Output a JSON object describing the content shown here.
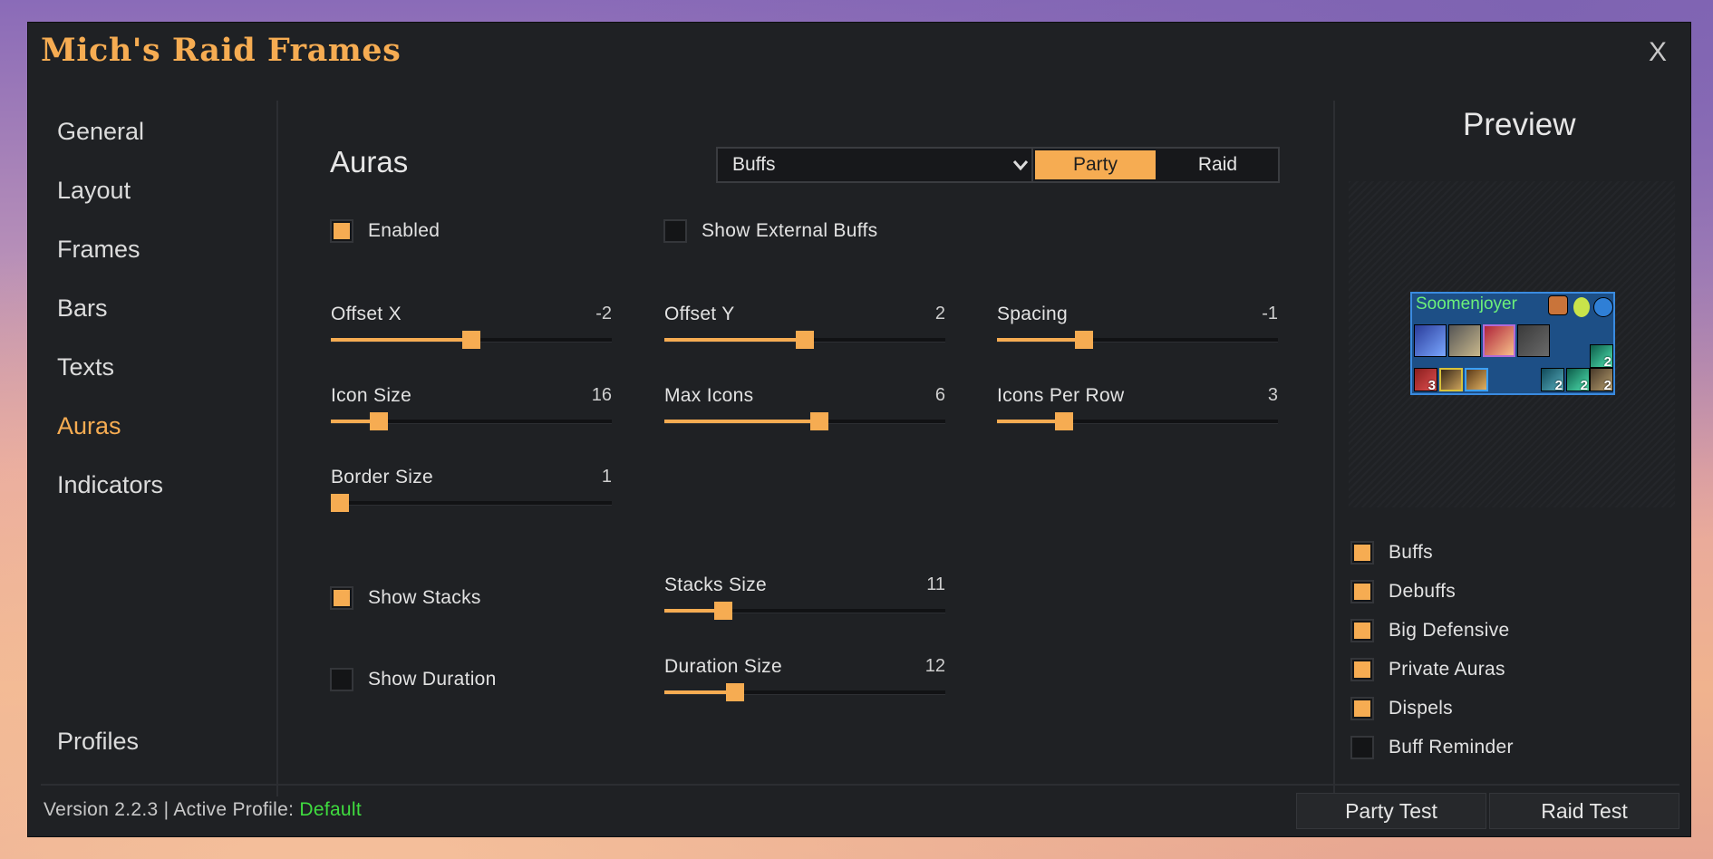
{
  "app": {
    "title": "Mich's Raid Frames",
    "close_label": "X"
  },
  "nav": {
    "items": [
      "General",
      "Layout",
      "Frames",
      "Bars",
      "Texts",
      "Auras",
      "Indicators"
    ],
    "active": "Auras",
    "profiles_label": "Profiles"
  },
  "auras": {
    "title": "Auras",
    "dropdown": {
      "selected": "Buffs"
    },
    "segment": {
      "options": [
        "Party",
        "Raid"
      ],
      "selected": "Party"
    },
    "enabled": {
      "label": "Enabled",
      "checked": true
    },
    "show_external_buffs": {
      "label": "Show External Buffs",
      "checked": false
    },
    "sliders": {
      "offset_x": {
        "label": "Offset X",
        "value": "-2",
        "fraction": 0.5
      },
      "offset_y": {
        "label": "Offset Y",
        "value": "2",
        "fraction": 0.5
      },
      "spacing": {
        "label": "Spacing",
        "value": "-1",
        "fraction": 0.31
      },
      "icon_size": {
        "label": "Icon Size",
        "value": "16",
        "fraction": 0.17
      },
      "max_icons": {
        "label": "Max Icons",
        "value": "6",
        "fraction": 0.55
      },
      "icons_per_row": {
        "label": "Icons Per Row",
        "value": "3",
        "fraction": 0.24
      },
      "border_size": {
        "label": "Border Size",
        "value": "1",
        "fraction": 0.02
      },
      "stacks_size": {
        "label": "Stacks Size",
        "value": "11",
        "fraction": 0.21
      },
      "duration_size": {
        "label": "Duration Size",
        "value": "12",
        "fraction": 0.25
      }
    },
    "show_stacks": {
      "label": "Show Stacks",
      "checked": true
    },
    "show_duration": {
      "label": "Show Duration",
      "checked": false
    }
  },
  "preview": {
    "title": "Preview",
    "unit_name": "Soomenjoyer",
    "stack_counts": [
      "2",
      "3",
      "2",
      "2",
      "2"
    ],
    "toggles": [
      {
        "label": "Buffs",
        "checked": true
      },
      {
        "label": "Debuffs",
        "checked": true
      },
      {
        "label": "Big Defensive",
        "checked": true
      },
      {
        "label": "Private Auras",
        "checked": true
      },
      {
        "label": "Dispels",
        "checked": true
      },
      {
        "label": "Buff Reminder",
        "checked": false
      }
    ]
  },
  "footer": {
    "version_text": "Version 2.2.3 | Active Profile: ",
    "profile_name": "Default",
    "party_test_label": "Party Test",
    "raid_test_label": "Raid Test"
  },
  "colors": {
    "accent": "#f6ac52",
    "profile": "#3fdc3f",
    "unit_name": "#6cf07a"
  }
}
